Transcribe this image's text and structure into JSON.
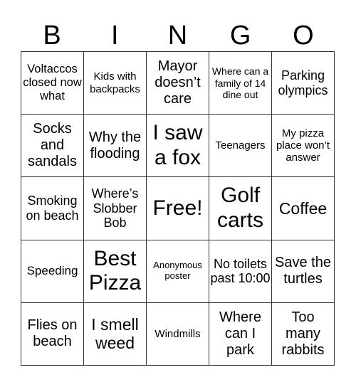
{
  "header": {
    "letters": [
      "B",
      "I",
      "N",
      "G",
      "O"
    ]
  },
  "cells": [
    "Voltaccos closed now what",
    "Kids with backpacks",
    "Mayor doesn’t care",
    "Where can a family of 14 dine out",
    "Parking olympics",
    "Socks and sandals",
    "Why the flooding",
    "I saw a fox",
    "Teenagers",
    "My pizza place won’t answer",
    "Smoking on beach",
    "Where’s Slobber Bob",
    "Free!",
    "Golf carts",
    "Coffee",
    "Speeding",
    "Best Pizza",
    "Anonymous poster",
    "No toilets past 10:00",
    "Save the turtles",
    "Flies on beach",
    "I smell weed",
    "Windmills",
    "Where can I park",
    "Too many rabbits"
  ]
}
